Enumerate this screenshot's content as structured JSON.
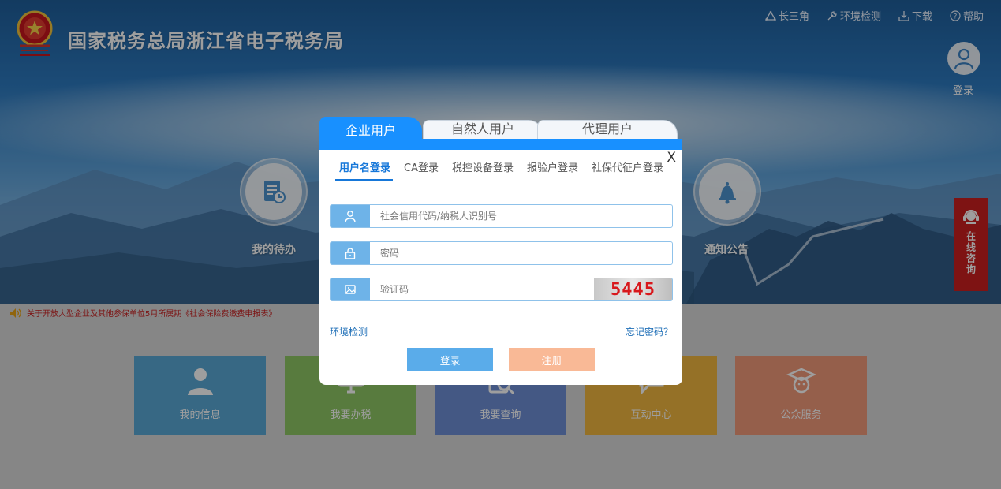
{
  "header": {
    "site_title": "国家税务总局浙江省电子税务局",
    "nav": [
      {
        "label": "长三角",
        "icon": "triangle-icon"
      },
      {
        "label": "环境检测",
        "icon": "wrench-icon"
      },
      {
        "label": "下载",
        "icon": "download-icon"
      },
      {
        "label": "帮助",
        "icon": "help-icon"
      }
    ],
    "login_label": "登录"
  },
  "hero": {
    "todo_label": "我的待办",
    "notice_label": "通知公告"
  },
  "consult": {
    "label": "在线咨询"
  },
  "notice_bar": {
    "text": "关于开放大型企业及其他参保单位5月所属期《社会保险费缴费申报表》"
  },
  "tiles": [
    {
      "label": "我的信息",
      "color": "#5aa9d6",
      "icon": "person-icon"
    },
    {
      "label": "我要办税",
      "color": "#8ec764",
      "icon": "monitor-icon"
    },
    {
      "label": "我要查询",
      "color": "#6f8fd6",
      "icon": "search-doc-icon"
    },
    {
      "label": "互动中心",
      "color": "#f0b740",
      "icon": "chat-icon"
    },
    {
      "label": "公众服务",
      "color": "#f1997a",
      "icon": "graduate-icon"
    }
  ],
  "modal": {
    "tabs": [
      "企业用户",
      "自然人用户",
      "代理用户"
    ],
    "close_label": "X",
    "subtabs": [
      "用户名登录",
      "CA登录",
      "税控设备登录",
      "报验户登录",
      "社保代征户登录"
    ],
    "fields": {
      "username_placeholder": "社会信用代码/纳税人识别号",
      "password_placeholder": "密码",
      "captcha_placeholder": "验证码",
      "captcha_text": "5445"
    },
    "env_check_link": "环境检测",
    "forgot_link": "忘记密码？",
    "login_button": "登录",
    "register_button": "注册"
  },
  "colors": {
    "primary": "#1890ff",
    "login_button": "#5aacea",
    "register_button": "#f9b996",
    "consult": "#cc1f1f"
  }
}
